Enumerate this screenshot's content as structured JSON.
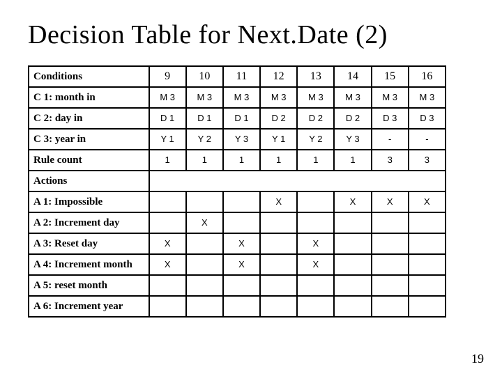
{
  "title": "Decision Table for Next.Date (2)",
  "page_number": "19",
  "chart_data": {
    "type": "table",
    "title": "Decision Table for Next.Date (2)",
    "columns": [
      "9",
      "10",
      "11",
      "12",
      "13",
      "14",
      "15",
      "16"
    ],
    "conditions": [
      {
        "label": "C 1: month in",
        "values": [
          "M 3",
          "M 3",
          "M 3",
          "M 3",
          "M 3",
          "M 3",
          "M 3",
          "M 3"
        ]
      },
      {
        "label": "C 2: day in",
        "values": [
          "D 1",
          "D 1",
          "D 1",
          "D 2",
          "D 2",
          "D 2",
          "D 3",
          "D 3"
        ]
      },
      {
        "label": "C 3: year in",
        "values": [
          "Y 1",
          "Y 2",
          "Y 3",
          "Y 1",
          "Y 2",
          "Y 3",
          "-",
          "-"
        ]
      },
      {
        "label": "Rule count",
        "values": [
          "1",
          "1",
          "1",
          "1",
          "1",
          "1",
          "3",
          "3"
        ]
      }
    ],
    "conditions_header": "Conditions",
    "actions_header": "Actions",
    "actions": [
      {
        "label": "A 1: Impossible",
        "values": [
          "",
          "",
          "",
          "X",
          "",
          "X",
          "X",
          "X"
        ]
      },
      {
        "label": "A 2: Increment day",
        "values": [
          "",
          "X",
          "",
          "",
          "",
          "",
          "",
          ""
        ]
      },
      {
        "label": "A 3: Reset day",
        "values": [
          "X",
          "",
          "X",
          "",
          "X",
          "",
          "",
          ""
        ]
      },
      {
        "label": "A 4: Increment month",
        "values": [
          "X",
          "",
          "X",
          "",
          "X",
          "",
          "",
          ""
        ]
      },
      {
        "label": "A 5: reset month",
        "values": [
          "",
          "",
          "",
          "",
          "",
          "",
          "",
          ""
        ]
      },
      {
        "label": "A 6: Increment year",
        "values": [
          "",
          "",
          "",
          "",
          "",
          "",
          "",
          ""
        ]
      }
    ]
  }
}
